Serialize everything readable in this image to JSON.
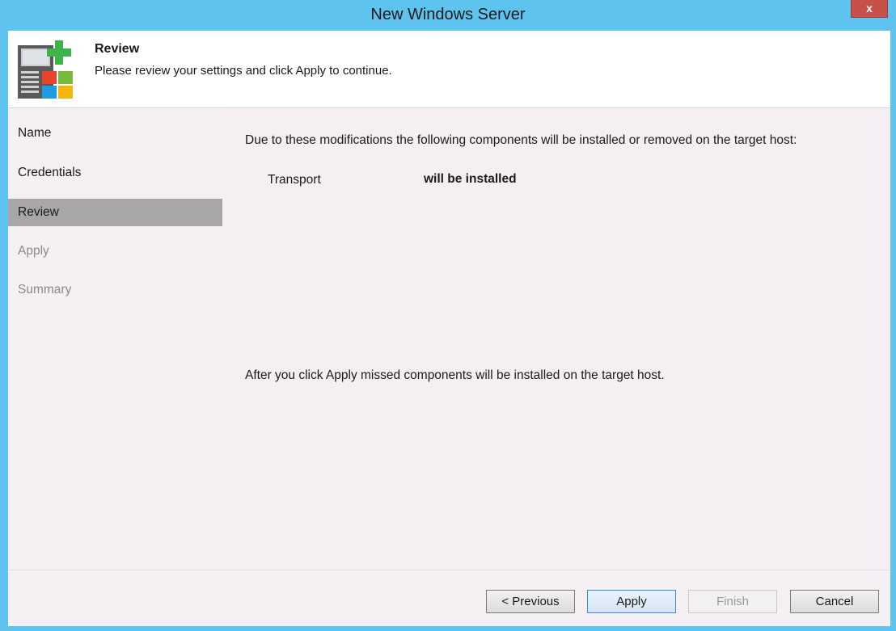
{
  "window": {
    "title": "New Windows Server",
    "close_label": "x"
  },
  "header": {
    "icon": "server-add-windows-icon",
    "title": "Review",
    "subtitle": "Please review your settings and click Apply to continue."
  },
  "sidebar": {
    "items": [
      {
        "label": "Name",
        "state": "normal"
      },
      {
        "label": "Credentials",
        "state": "normal"
      },
      {
        "label": "Review",
        "state": "active"
      },
      {
        "label": "Apply",
        "state": "disabled"
      },
      {
        "label": "Summary",
        "state": "disabled"
      }
    ]
  },
  "content": {
    "intro": "Due to these modifications the following components will be installed or removed on the target host:",
    "components": [
      {
        "name": "Transport",
        "status": "will be installed"
      }
    ],
    "note": "After you click Apply missed components will be installed on the target host."
  },
  "footer": {
    "previous_label": "< Previous",
    "apply_label": "Apply",
    "finish_label": "Finish",
    "cancel_label": "Cancel"
  },
  "colors": {
    "titlebar": "#5ec4ef",
    "close_button": "#c7504a",
    "active_nav": "#a8a6a8",
    "panel": "#f4f0f3"
  }
}
